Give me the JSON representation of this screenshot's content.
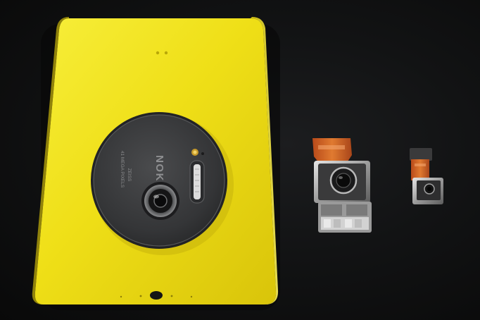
{
  "photo": {
    "subject": "yellow phone back with camera modules",
    "colors": {
      "background": "#111214",
      "phone_body": "#f2e21a",
      "camera_disc": "#3a3b3d",
      "flex_cable": "#c8561f"
    }
  },
  "phone": {
    "brand_text": "NOKIA",
    "lens_text": "41 MEGA PIXELS",
    "lens_brand": "ZEISS"
  },
  "modules": {
    "large_module": "main camera module",
    "small_module": "small camera module"
  }
}
